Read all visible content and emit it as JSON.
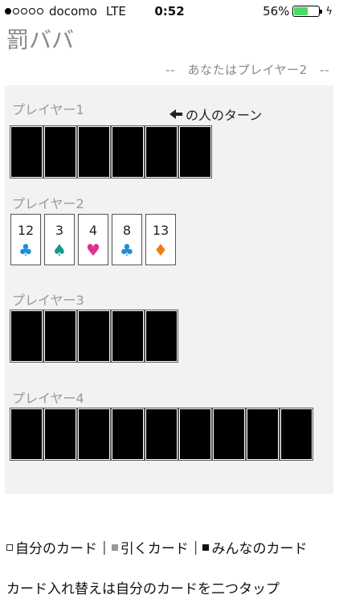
{
  "status_bar": {
    "carrier": "docomo",
    "network": "LTE",
    "time": "0:52",
    "battery_percent": "56%",
    "battery_level": 0.56,
    "signal_bars_filled": 1,
    "signal_bars_total": 5
  },
  "app": {
    "title": "罰ババ",
    "you_are": "--　あなたはプレイヤー2　--"
  },
  "turn_indicator": "の人のターン",
  "players": [
    {
      "label": "プレイヤー1",
      "card_count": 6
    },
    {
      "label": "プレイヤー2",
      "cards": [
        {
          "rank": "12",
          "suit": "♣",
          "color": "#1e8fd6"
        },
        {
          "rank": "3",
          "suit": "♠",
          "color": "#129a8c"
        },
        {
          "rank": "4",
          "suit": "♥",
          "color": "#e0338a"
        },
        {
          "rank": "8",
          "suit": "♣",
          "color": "#1e8fd6"
        },
        {
          "rank": "13",
          "suit": "♦",
          "color": "#f07c13"
        }
      ]
    },
    {
      "label": "プレイヤー3",
      "card_count": 5
    },
    {
      "label": "プレイヤー4",
      "card_count": 9
    }
  ],
  "legend": {
    "own_cards": "自分のカード",
    "draw_card": "引くカード",
    "all_cards": "みんなのカード",
    "separator": "|"
  },
  "hint": "カード入れ替えは自分のカードを二つタップ"
}
